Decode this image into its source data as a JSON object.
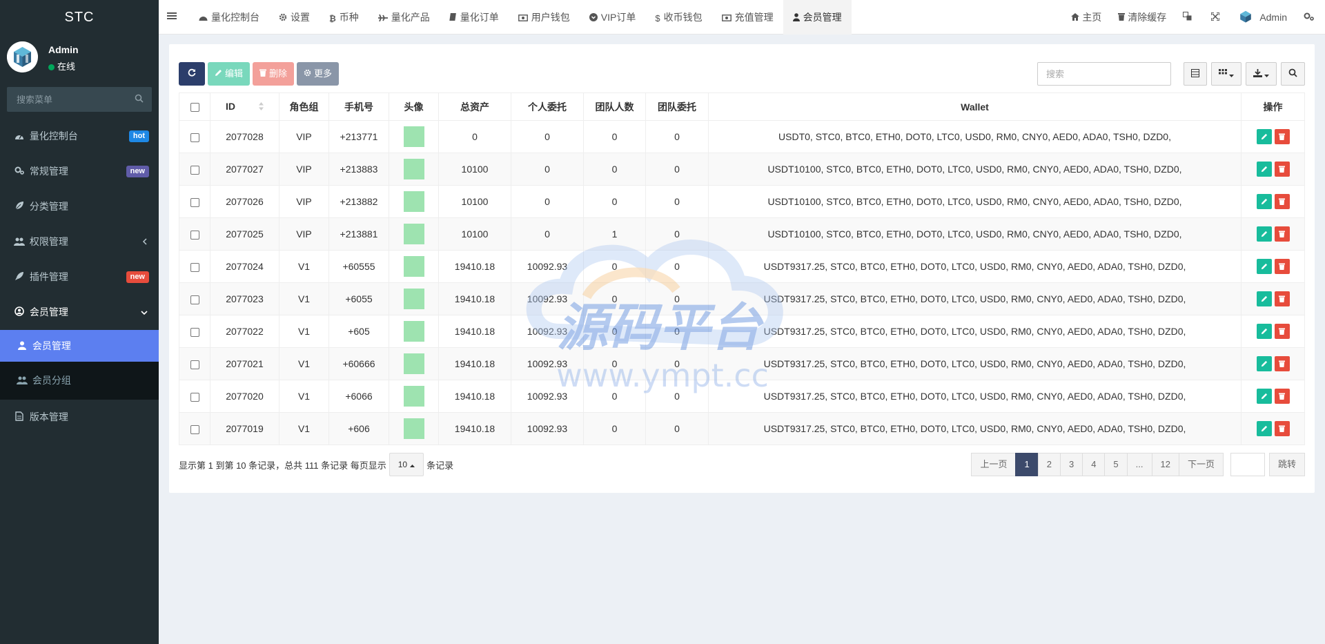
{
  "brand": "STC",
  "user": {
    "name": "Admin",
    "status": "在线"
  },
  "sidebar": {
    "search_placeholder": "搜索菜单",
    "items": [
      {
        "label": "量化控制台",
        "badge": "hot",
        "badge_color": "#1e88e5"
      },
      {
        "label": "常规管理",
        "badge": "new",
        "badge_color": "#605ca8"
      },
      {
        "label": "分类管理"
      },
      {
        "label": "权限管理"
      },
      {
        "label": "插件管理",
        "badge": "new",
        "badge_color": "#e74c3c"
      },
      {
        "label": "会员管理"
      },
      {
        "label": "会员管理"
      },
      {
        "label": "会员分组"
      },
      {
        "label": "版本管理"
      }
    ]
  },
  "topnav": {
    "tabs": [
      "量化控制台",
      "设置",
      "币种",
      "量化产品",
      "量化订单",
      "用户钱包",
      "VIP订单",
      "收币钱包",
      "充值管理",
      "会员管理"
    ],
    "right": [
      "主页",
      "清除缓存",
      "Admin"
    ]
  },
  "toolbar": {
    "edit": "编辑",
    "delete": "删除",
    "more": "更多",
    "search_placeholder": "搜索"
  },
  "table": {
    "headers": [
      "ID",
      "角色组",
      "手机号",
      "头像",
      "总资产",
      "个人委托",
      "团队人数",
      "团队委托",
      "Wallet",
      "操作"
    ],
    "rows": [
      [
        "2077028",
        "VIP",
        "+213771",
        "0",
        "0",
        "0",
        "0",
        "USDT0, STC0, BTC0, ETH0, DOT0, LTC0, USD0, RM0, CNY0, AED0, ADA0, TSH0, DZD0,"
      ],
      [
        "2077027",
        "VIP",
        "+213883",
        "10100",
        "0",
        "0",
        "0",
        "USDT10100, STC0, BTC0, ETH0, DOT0, LTC0, USD0, RM0, CNY0, AED0, ADA0, TSH0, DZD0,"
      ],
      [
        "2077026",
        "VIP",
        "+213882",
        "10100",
        "0",
        "0",
        "0",
        "USDT10100, STC0, BTC0, ETH0, DOT0, LTC0, USD0, RM0, CNY0, AED0, ADA0, TSH0, DZD0,"
      ],
      [
        "2077025",
        "VIP",
        "+213881",
        "10100",
        "0",
        "1",
        "0",
        "USDT10100, STC0, BTC0, ETH0, DOT0, LTC0, USD0, RM0, CNY0, AED0, ADA0, TSH0, DZD0,"
      ],
      [
        "2077024",
        "V1",
        "+60555",
        "19410.18",
        "10092.93",
        "0",
        "0",
        "USDT9317.25, STC0, BTC0, ETH0, DOT0, LTC0, USD0, RM0, CNY0, AED0, ADA0, TSH0, DZD0,"
      ],
      [
        "2077023",
        "V1",
        "+6055",
        "19410.18",
        "10092.93",
        "0",
        "0",
        "USDT9317.25, STC0, BTC0, ETH0, DOT0, LTC0, USD0, RM0, CNY0, AED0, ADA0, TSH0, DZD0,"
      ],
      [
        "2077022",
        "V1",
        "+605",
        "19410.18",
        "10092.93",
        "0",
        "0",
        "USDT9317.25, STC0, BTC0, ETH0, DOT0, LTC0, USD0, RM0, CNY0, AED0, ADA0, TSH0, DZD0,"
      ],
      [
        "2077021",
        "V1",
        "+60666",
        "19410.18",
        "10092.93",
        "0",
        "0",
        "USDT9317.25, STC0, BTC0, ETH0, DOT0, LTC0, USD0, RM0, CNY0, AED0, ADA0, TSH0, DZD0,"
      ],
      [
        "2077020",
        "V1",
        "+6066",
        "19410.18",
        "10092.93",
        "0",
        "0",
        "USDT9317.25, STC0, BTC0, ETH0, DOT0, LTC0, USD0, RM0, CNY0, AED0, ADA0, TSH0, DZD0,"
      ],
      [
        "2077019",
        "V1",
        "+606",
        "19410.18",
        "10092.93",
        "0",
        "0",
        "USDT9317.25, STC0, BTC0, ETH0, DOT0, LTC0, USD0, RM0, CNY0, AED0, ADA0, TSH0, DZD0,"
      ]
    ]
  },
  "footer": {
    "info_prefix": "显示第 1 到第 10 条记录，总共 111 条记录 每页显示",
    "page_size": "10",
    "info_suffix": "条记录"
  },
  "pager": {
    "prev": "上一页",
    "pages": [
      "1",
      "2",
      "3",
      "4",
      "5",
      "...",
      "12"
    ],
    "next": "下一页",
    "jump": "跳转"
  },
  "watermark": {
    "title": "源码平台",
    "url": "www.ympt.cc"
  }
}
